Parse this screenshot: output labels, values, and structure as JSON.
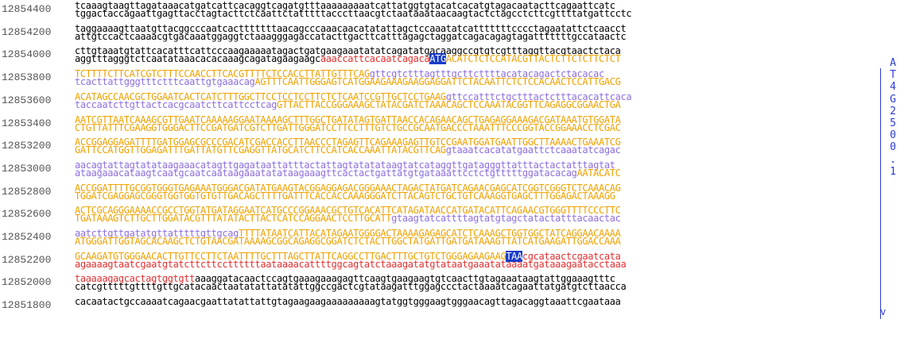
{
  "rows": [
    {
      "coord": "12854400",
      "l1": [
        [
          "nc",
          "tcaaagtaagttagataaacatgatcattcacaggtcagatgtttaaaaaaaaatcattatggtgtacatcacatgtagacaatacttcagaattcatc"
        ]
      ],
      "l2": [
        [
          "nc",
          "tggactaccagaattgagttacctagtacttctcaattctatttttacccttaacgtctaataaataacaagtactctagcctcttcgttttatgattcctc"
        ]
      ]
    },
    {
      "coord": "12854200",
      "l1": [
        [
          "nc",
          "taggaaaagttaatgttacggcccaatcactttttttaacagcccaaacaacatatattagctccaaatatcatttttttcccctagaatattctcaacct"
        ]
      ],
      "l2": [
        [
          "nc",
          "attgtccactcaaaacgtgacaaatggaggtctaaagggagaccatacttgacttcatttagagctaggatcagacagagtagatttttttgccataactc"
        ]
      ]
    },
    {
      "coord": "12854000",
      "l1": [
        [
          "nc",
          "cttgtaaatgtattcacatttcattcccaagaaaaatagactgatgaagaaatatatcagatatgacaaggccgtgtcgtttaggttacgtaactctaca"
        ]
      ],
      "l2": [
        [
          "nc",
          "aggtttagggtctcaatataaacacacaaagcagatagaagaagc"
        ],
        [
          "utr",
          "aaaccattcacaatcagaca"
        ],
        [
          "codon",
          "ATG"
        ],
        [
          "exon",
          "ACATCTCTCCATACGTTACTCTTCTCTTCTCT"
        ]
      ]
    },
    {
      "coord": "12853800",
      "l1": [
        [
          "exon",
          "TCTTTTCTTCATCGTCTTTCCAACCTTCACGTTTTCTCCACCTTATTGTTTCAG"
        ],
        [
          "intron",
          "gttcgtctttagtttgcttcttttacatacagactctacacac"
        ]
      ],
      "l2": [
        [
          "intron",
          "tcacttattgggtttctttcaattgtgaaacag"
        ],
        [
          "exon",
          "AGTTTCAATTGGGAGTCATGGAAGAAAGAAGGAGGATTCTACAATTCTCTCCACAACTCCATTGACG"
        ]
      ]
    },
    {
      "coord": "12853600",
      "l1": [
        [
          "exon",
          "ACATAGCCAACGCTGGAATCACTCATCTTTGGCTTCCTCCTCCTTCTCTCAATCCGTTGCTCCTGAAG"
        ],
        [
          "intron",
          "gttccatttctgctttactctttacacattcaca"
        ]
      ],
      "l2": [
        [
          "intron",
          "taccaatcttgttactcacgcaatcttcattcctcag"
        ],
        [
          "exon",
          "GTTACTTACCGGGAAAGCTATACGATCTAAACAGCTCCAAATACGGTTCAGAGGCGGAACTGA"
        ]
      ]
    },
    {
      "coord": "12853400",
      "l1": [
        [
          "exon",
          "AATCGTTAATCAAAGCGTTGAATCAAAAAGGAATAAAAGCTTTGGCTGATATAGTGATTAACCACAGAACAGCTGAGAGGAAAGACGATAAATGTGGATA"
        ]
      ],
      "l2": [
        [
          "exon",
          "CTGTTATTTCGAAGGTGGGACTTCCGATGATCGTCTTGATTGGGATCCTTCCTTTGTCTGCCGCAATGACCCTAAATTTCCCGGTACCGGAAACCTCGAC"
        ]
      ]
    },
    {
      "coord": "12853200",
      "l1": [
        [
          "exon",
          "ACCGGAGGAGATTTTGATGGAGCGCCCGACATCGACCACCTTAACCCTAGAGTTCAGAAAGAGTTGTCCGAATGGATGAATTGGCTTAAAACTGAAATCG"
        ]
      ],
      "l2": [
        [
          "exon",
          "GATTCCATGGTTGGAGATTTGATTATGTTCGAGGTTATGCATCTTCCATCACCAAATTATACGTTCAG"
        ],
        [
          "intron",
          "gtaaatcacatatgaattctcaaatatcagac"
        ]
      ]
    },
    {
      "coord": "12853000",
      "l1": [
        [
          "intron",
          "aacagtattagtatataagaaacatagttgagataattatttactattagtatatataagtatcataggttgatagggttatttactactatttagtat"
        ]
      ],
      "l2": [
        [
          "intron",
          "ataagaaacataagtcaatgcaatcaataagaaatatataagaaagttcactactgattatgtgataaattcctctgtttttggatacacag"
        ],
        [
          "exon",
          "AATACATC"
        ]
      ]
    },
    {
      "coord": "12852800",
      "l1": [
        [
          "exon",
          "ACCGGATTTTGCGGTGGGTGAGAAATGGGACGATATGAAGTACGGAGGAGACGGGAAACTAGACTATGATCAGAACGAGCATCGGTCGGGTCTCAAACAG"
        ]
      ],
      "l2": [
        [
          "exon",
          "TGGATCGAGGAGCGGGTGGTGGTGTGTTGACAGCTTTTGATTTCACCACCAAAGGGATCTTACAGTCTGCTGTCAAAGGTGAGCTTTGGAGACTAAAGG"
        ]
      ]
    },
    {
      "coord": "12852600",
      "l1": [
        [
          "exon",
          "ACTCGCAGGGAAAACCGCCTGGTATGATAGGAATCATGCCCGGAAACGCTGTCACATTCATAGATAACCATGATACATTCAGAACGTGGGTTTTCCCTTC"
        ]
      ],
      "l2": [
        [
          "exon",
          "TGATAAAGTCTTGCTTGGATACGTTTATATACTTACTCATCCAGGAACTCCTTGCATT"
        ],
        [
          "intron",
          "gtaagtatcattttagtatgtagctatactatttacaactac"
        ]
      ]
    },
    {
      "coord": "12852400",
      "l1": [
        [
          "intron",
          "aatcttgttgatatgttatttttgttgcag"
        ],
        [
          "exon",
          "TTTTATAATCATTACATAGAATGGGGACTAAAAGAGAGCATCTCAAAGCTGGTGGCTATCAGGAACAAAA"
        ]
      ],
      "l2": [
        [
          "exon",
          "ATGGGATTGGTAGCACAAGCTCTGTAACGATAAAAGCGGCAGAGGCGGATCTCTACTTGGCTATGATTGATGATAAAGTTATCATGAAGATTGGACCAAA"
        ]
      ]
    },
    {
      "coord": "12852200",
      "l1": [
        [
          "exon",
          "GCAAGATGTGGGAACACTTGTTCCTTCTAATTTTGCTTTAGCTTATTCAGGCCTTGACTTTGCTGTCTGGGAGAAGAAG"
        ],
        [
          "codon",
          "TAA"
        ],
        [
          "utr",
          "cgcataactcgaatcata"
        ]
      ],
      "l2": [
        [
          "utr",
          "agaaaagtaatcgaatgtatcttcttccttttttaataaaacattttggcagtatctaaagatatgtataatgaaatataaaatgataaagaatacctaaa"
        ]
      ]
    },
    {
      "coord": "12852000",
      "l1": [
        [
          "utr",
          "taaaaagagcactagtggtgtt"
        ],
        [
          "nc",
          "aaaggatacaactccagtgaaagaaagagttcaagtgaagaagtgtcaacttgtagaaataagtattggaaagtttc"
        ]
      ],
      "l2": [
        [
          "nc",
          "catcgtttttgttttgttgcatacaactaatatattatatattggccgactcgtataagatttggagccctactaaaatcagaattatgatgtcttaacca"
        ]
      ]
    },
    {
      "coord": "12851800",
      "l1": [
        [
          "nc",
          "cacaatactgccaaaatcagaacgaattatattattgtagaagaagaaaaaaaaagtatggtgggaagtgggaacagttagacaggtaaattcgaataaa"
        ]
      ],
      "l2": [
        [
          "nc",
          ""
        ]
      ]
    }
  ],
  "gene_track": {
    "label_chars": [
      "A",
      "T",
      "4",
      "G",
      "2",
      "5",
      "0",
      "0",
      ".",
      "1"
    ],
    "strand_arrow": "v"
  }
}
